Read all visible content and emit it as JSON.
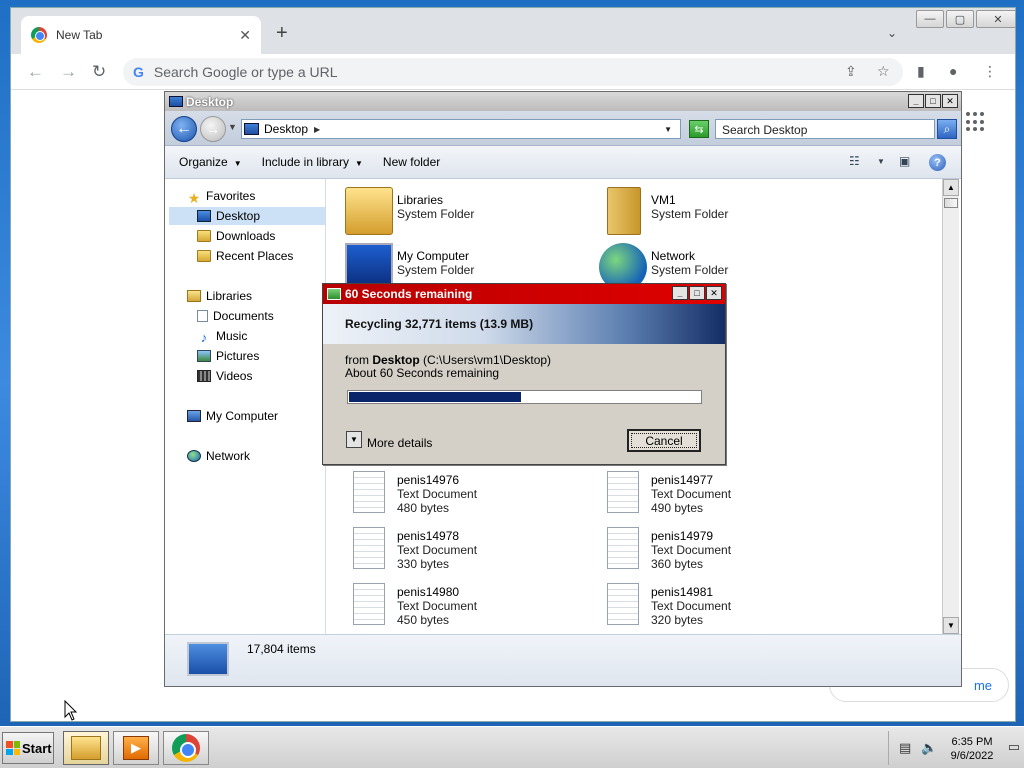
{
  "chrome": {
    "tab_title": "New Tab",
    "tab_close": "✕",
    "new_tab": "+",
    "tab_search": "⌄",
    "min": "—",
    "max": "▢",
    "close": "✕",
    "back": "←",
    "forward": "→",
    "reload": "↻",
    "omnibox_placeholder": "Search Google or type a URL",
    "share_icon": "⇪",
    "bookmark_icon": "☆",
    "sidepanel_icon": "▮",
    "profile_icon": "●",
    "menu_icon": "⋮",
    "customize_label": "me"
  },
  "explorer": {
    "title": "Desktop",
    "address": {
      "crumb": "Desktop",
      "arrow": "▶",
      "dropdown": "▼"
    },
    "refresh": "⇆",
    "search_placeholder": "Search Desktop",
    "search_icon": "⌕",
    "commands": {
      "organize": "Organize",
      "include": "Include in library",
      "new_folder": "New folder",
      "dd": "▼"
    },
    "help": "?",
    "nav": {
      "favorites": "Favorites",
      "desktop": "Desktop",
      "downloads": "Downloads",
      "recent": "Recent Places",
      "libraries": "Libraries",
      "documents": "Documents",
      "music": "Music",
      "pictures": "Pictures",
      "videos": "Videos",
      "computer": "My Computer",
      "network": "Network"
    },
    "items": [
      {
        "name": "Libraries",
        "type": "System Folder"
      },
      {
        "name": "VM1",
        "type": "System Folder"
      },
      {
        "name": "My Computer",
        "type": "System Folder"
      },
      {
        "name": "Network",
        "type": "System Folder"
      },
      {
        "name": "penis14976",
        "type": "Text Document",
        "size": "480 bytes"
      },
      {
        "name": "penis14977",
        "type": "Text Document",
        "size": "490 bytes"
      },
      {
        "name": "penis14978",
        "type": "Text Document",
        "size": "330 bytes"
      },
      {
        "name": "penis14979",
        "type": "Text Document",
        "size": "360 bytes"
      },
      {
        "name": "penis14980",
        "type": "Text Document",
        "size": "450 bytes"
      },
      {
        "name": "penis14981",
        "type": "Text Document",
        "size": "320 bytes"
      }
    ],
    "item_count": "17,804 items"
  },
  "dialog": {
    "title": "60 Seconds remaining",
    "header": "Recycling 32,771 items (13.9 MB)",
    "from_prefix": "from ",
    "from_name": "Desktop",
    "from_path": " (C:\\Users\\vm1\\Desktop)",
    "remaining": "About 60 Seconds remaining",
    "progress_fraction": 0.49,
    "more_details": "More details",
    "more_details_arrow": "▼",
    "cancel": "Cancel"
  },
  "taskbar": {
    "start": "Start",
    "time": "6:35 PM",
    "date": "9/6/2022",
    "media_glyph": "▶"
  },
  "colors": {
    "dialog_title": "#cc0000",
    "progress_fill": "#0a246a"
  }
}
